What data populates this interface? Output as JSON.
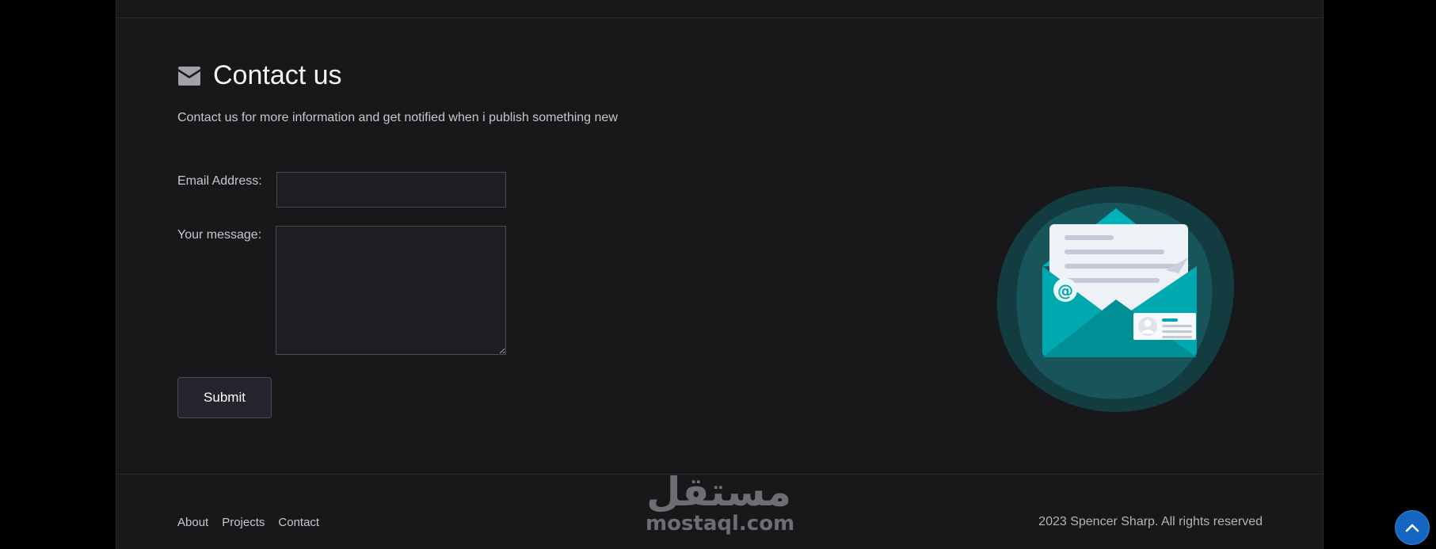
{
  "contact": {
    "title": "Contact us",
    "icon": "envelope-icon",
    "intro": "Contact us for more information and get notified when i publish something new",
    "email_label": "Email Address:",
    "email_value": "",
    "message_label": "Your message:",
    "message_value": "",
    "submit_label": "Submit",
    "illustration": "open-envelope-illustration"
  },
  "footer": {
    "nav": [
      "About",
      "Projects",
      "Contact"
    ],
    "copyright": "2023 Spencer Sharp. All rights reserved"
  },
  "watermark": {
    "arabic": "مستقل",
    "latin": "mostaql.com"
  },
  "scroll_top": {
    "icon": "chevron-up-icon"
  },
  "colors": {
    "panel_bg": "#18181b",
    "page_bg": "#000000",
    "accent_teal": "#00acb4",
    "scroll_button": "#1466c2"
  }
}
